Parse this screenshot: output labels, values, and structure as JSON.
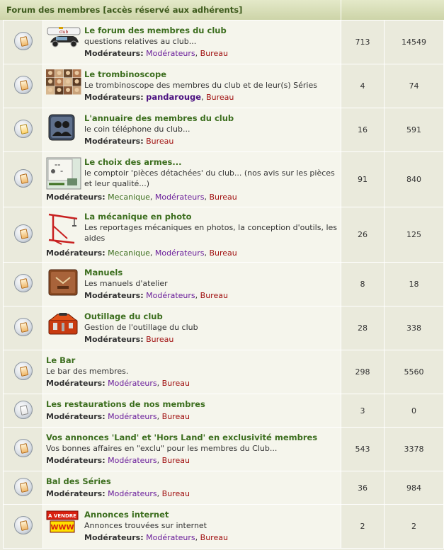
{
  "header": {
    "title": "Forum des membres [accès réservé aux adhérents]"
  },
  "mod_label": "Modérateurs:",
  "separator": ",",
  "forums": [
    {
      "title": "Le forum des membres du club",
      "desc": "questions relatives au club...",
      "topics": "713",
      "posts": "14549",
      "mods": [
        {
          "name": "Modérateurs",
          "color": "purple"
        },
        {
          "name": "Bureau",
          "color": "red"
        }
      ]
    },
    {
      "title": "Le trombinoscope",
      "desc": "Le trombinoscope des membres du club et de leur(s) Séries",
      "topics": "4",
      "posts": "74",
      "mods": [
        {
          "name": "pandarouge",
          "color": "bold-purple"
        },
        {
          "name": "Bureau",
          "color": "red"
        }
      ]
    },
    {
      "title": "L'annuaire des membres du club",
      "desc": "le coin téléphone du club...",
      "topics": "16",
      "posts": "591",
      "mods": [
        {
          "name": "Bureau",
          "color": "red"
        }
      ]
    },
    {
      "title": "Le choix des armes...",
      "desc": "le comptoir 'pièces détachées' du club... (nos avis sur les pièces et leur qualité...)",
      "topics": "91",
      "posts": "840",
      "mods": [
        {
          "name": "Mecanique",
          "color": "green"
        },
        {
          "name": "Modérateurs",
          "color": "purple"
        },
        {
          "name": "Bureau",
          "color": "red"
        }
      ]
    },
    {
      "title": "La mécanique en photo",
      "desc": "Les reportages mécaniques en photos, la conception d'outils, les aides",
      "topics": "26",
      "posts": "125",
      "mods": [
        {
          "name": "Mecanique",
          "color": "green"
        },
        {
          "name": "Modérateurs",
          "color": "purple"
        },
        {
          "name": "Bureau",
          "color": "red"
        }
      ]
    },
    {
      "title": "Manuels",
      "desc": "Les manuels d'atelier",
      "topics": "8",
      "posts": "18",
      "mods": [
        {
          "name": "Modérateurs",
          "color": "purple"
        },
        {
          "name": "Bureau",
          "color": "red"
        }
      ]
    },
    {
      "title": "Outillage du club",
      "desc": "Gestion de l'outillage du club",
      "topics": "28",
      "posts": "338",
      "mods": [
        {
          "name": "Bureau",
          "color": "red"
        }
      ]
    },
    {
      "title": "Le Bar",
      "desc": "Le bar des membres.",
      "topics": "298",
      "posts": "5560",
      "mods": [
        {
          "name": "Modérateurs",
          "color": "purple"
        },
        {
          "name": "Bureau",
          "color": "red"
        }
      ]
    },
    {
      "title": "Les restaurations de nos membres",
      "desc": "",
      "topics": "3",
      "posts": "0",
      "mods": [
        {
          "name": "Modérateurs",
          "color": "purple"
        },
        {
          "name": "Bureau",
          "color": "red"
        }
      ]
    },
    {
      "title": "Vos annonces 'Land' et 'Hors Land' en exclusivité membres",
      "desc": "Vos bonnes affaires en \"exclu\" pour les membres du Club...",
      "topics": "543",
      "posts": "3378",
      "mods": [
        {
          "name": "Modérateurs",
          "color": "purple"
        },
        {
          "name": "Bureau",
          "color": "red"
        }
      ]
    },
    {
      "title": "Bal des Séries",
      "desc": "",
      "topics": "36",
      "posts": "984",
      "mods": [
        {
          "name": "Modérateurs",
          "color": "purple"
        },
        {
          "name": "Bureau",
          "color": "red"
        }
      ]
    },
    {
      "title": "Annonces internet",
      "desc": "Annonces trouvées sur internet",
      "topics": "2",
      "posts": "2",
      "mods": [
        {
          "name": "Modérateurs",
          "color": "purple"
        },
        {
          "name": "Bureau",
          "color": "red"
        }
      ]
    }
  ],
  "logo_text": {
    "sale_sign_top": "A VENDRE",
    "sale_sign_bottom": "WWW"
  },
  "colors": {
    "title_green": "#3c6e1e",
    "mod_purple": "#6a1d9a",
    "mod_red": "#a01010",
    "header_bg": "#d9dfb6"
  }
}
